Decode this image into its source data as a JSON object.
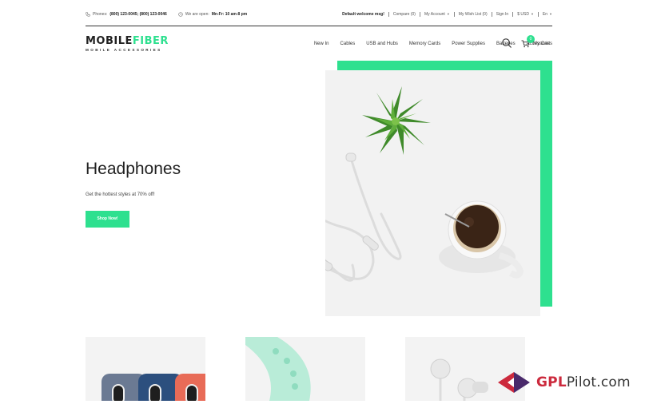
{
  "topbar": {
    "phones_label": "Phones:",
    "phones_value": "(800) 123-0045; (800) 123-0046",
    "hours_label": "We are open:",
    "hours_value": "Mn-Fr: 10 am-8 pm",
    "welcome": "Default welcome msg!",
    "compare": "Compare (0)",
    "account": "My Account",
    "wishlist": "My Wish List (0)",
    "signin": "Sign In",
    "currency": "$ USD",
    "language": "En"
  },
  "logo": {
    "part1": "MOBILE",
    "part2": "FIBER",
    "tagline": "MOBILE ACCESSORIES"
  },
  "nav": {
    "items": [
      "New In",
      "Cables",
      "USB and Hubs",
      "Memory Cards",
      "Power Supplies",
      "Batteries",
      "Accessories"
    ]
  },
  "cart": {
    "label": "My Cart",
    "count": "0"
  },
  "hero": {
    "title": "Headphones",
    "subtitle": "Get the hottest styles at 70% off!",
    "button": "Shop Now!"
  },
  "watermark": {
    "prefix": "GPL",
    "suffix": "Pilot.com"
  },
  "colors": {
    "accent": "#2ee08f",
    "watermark_red": "#cc2a3d",
    "watermark_purple": "#4a2a6b"
  },
  "icons": {
    "phone": "phone-icon",
    "clock": "clock-icon",
    "search": "search-icon",
    "cart": "cart-icon"
  }
}
